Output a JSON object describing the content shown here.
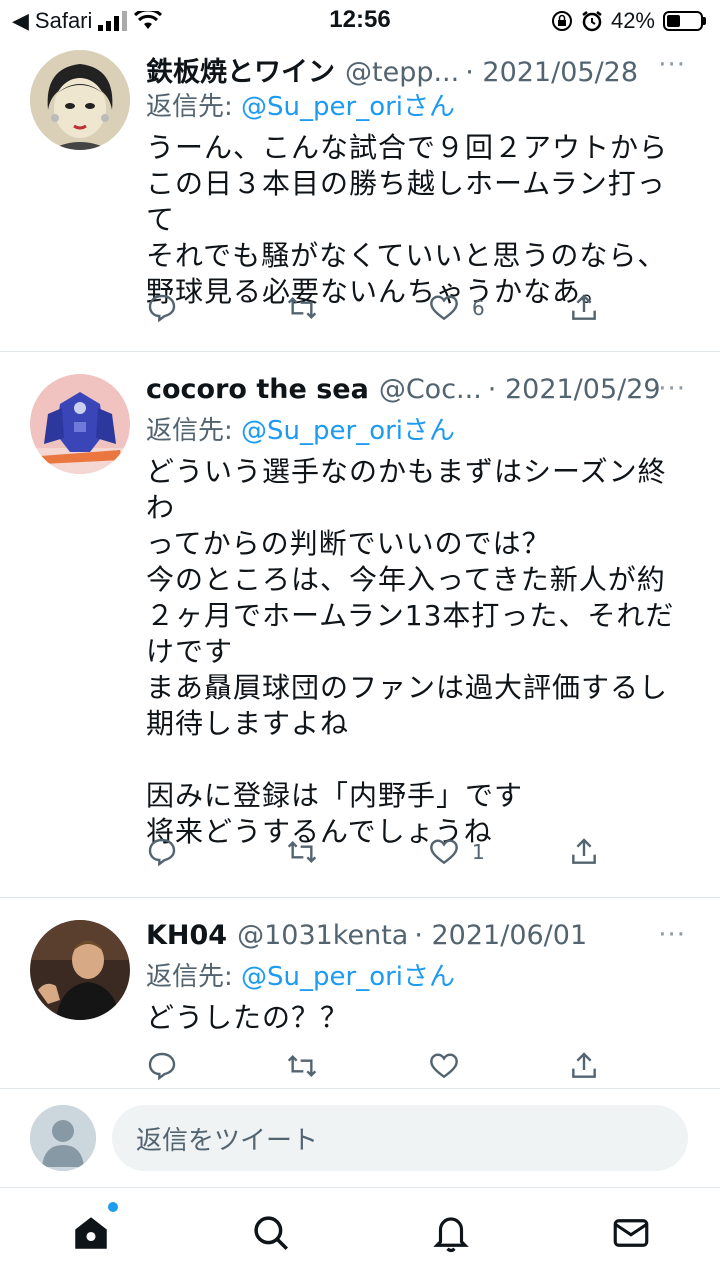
{
  "status_bar": {
    "back_app": "Safari",
    "time": "12:56",
    "battery_percent": "42%",
    "battery_level": 0.42
  },
  "tweets": [
    {
      "name": "鉄板焼とワイン",
      "handle": "@tepp...",
      "date": "· 2021/05/28",
      "reply_prefix": "返信先: ",
      "reply_to": "@Su_per_oriさん",
      "body": "うーん、こんな試合で９回２アウトから\nこの日３本目の勝ち越しホームラン打って\nそれでも騒がなくていいと思うのなら、\n野球見る必要ないんちゃうかなあ。",
      "like_count": "6",
      "avatar": "illustrated-woman-avatar"
    },
    {
      "name": "cocoro the sea",
      "handle": "@Coc...",
      "date": "· 2021/05/29",
      "reply_prefix": "返信先: ",
      "reply_to": "@Su_per_oriさん",
      "body": "どういう選手なのかもまずはシーズン終わ\nってからの判断でいいのでは？\n今のところは、今年入ってきた新人が約\n２ヶ月でホームラン13本打った、それだ\nけです\nまあ贔屓球団のファンは過大評価するし\n期待しますよね\n\n因みに登録は「内野手」です\n将来どうするんでしょうね",
      "like_count": "1",
      "avatar": "robot-figure-avatar"
    },
    {
      "name": "KH04",
      "handle": "@1031kenta",
      "date": "· 2021/06/01",
      "reply_prefix": "返信先: ",
      "reply_to": "@Su_per_oriさん",
      "body": "どうしたの？？",
      "like_count": "",
      "avatar": "photo-person-avatar"
    }
  ],
  "more_label": "···",
  "reply_bar": {
    "placeholder": "返信をツイート"
  },
  "tab_bar": {
    "icons": [
      "home-icon",
      "search-icon",
      "bell-icon",
      "mail-icon"
    ]
  },
  "colors": {
    "accent": "#1d9bf0",
    "secondary_text": "#536471",
    "divider": "#e1e6ea"
  }
}
